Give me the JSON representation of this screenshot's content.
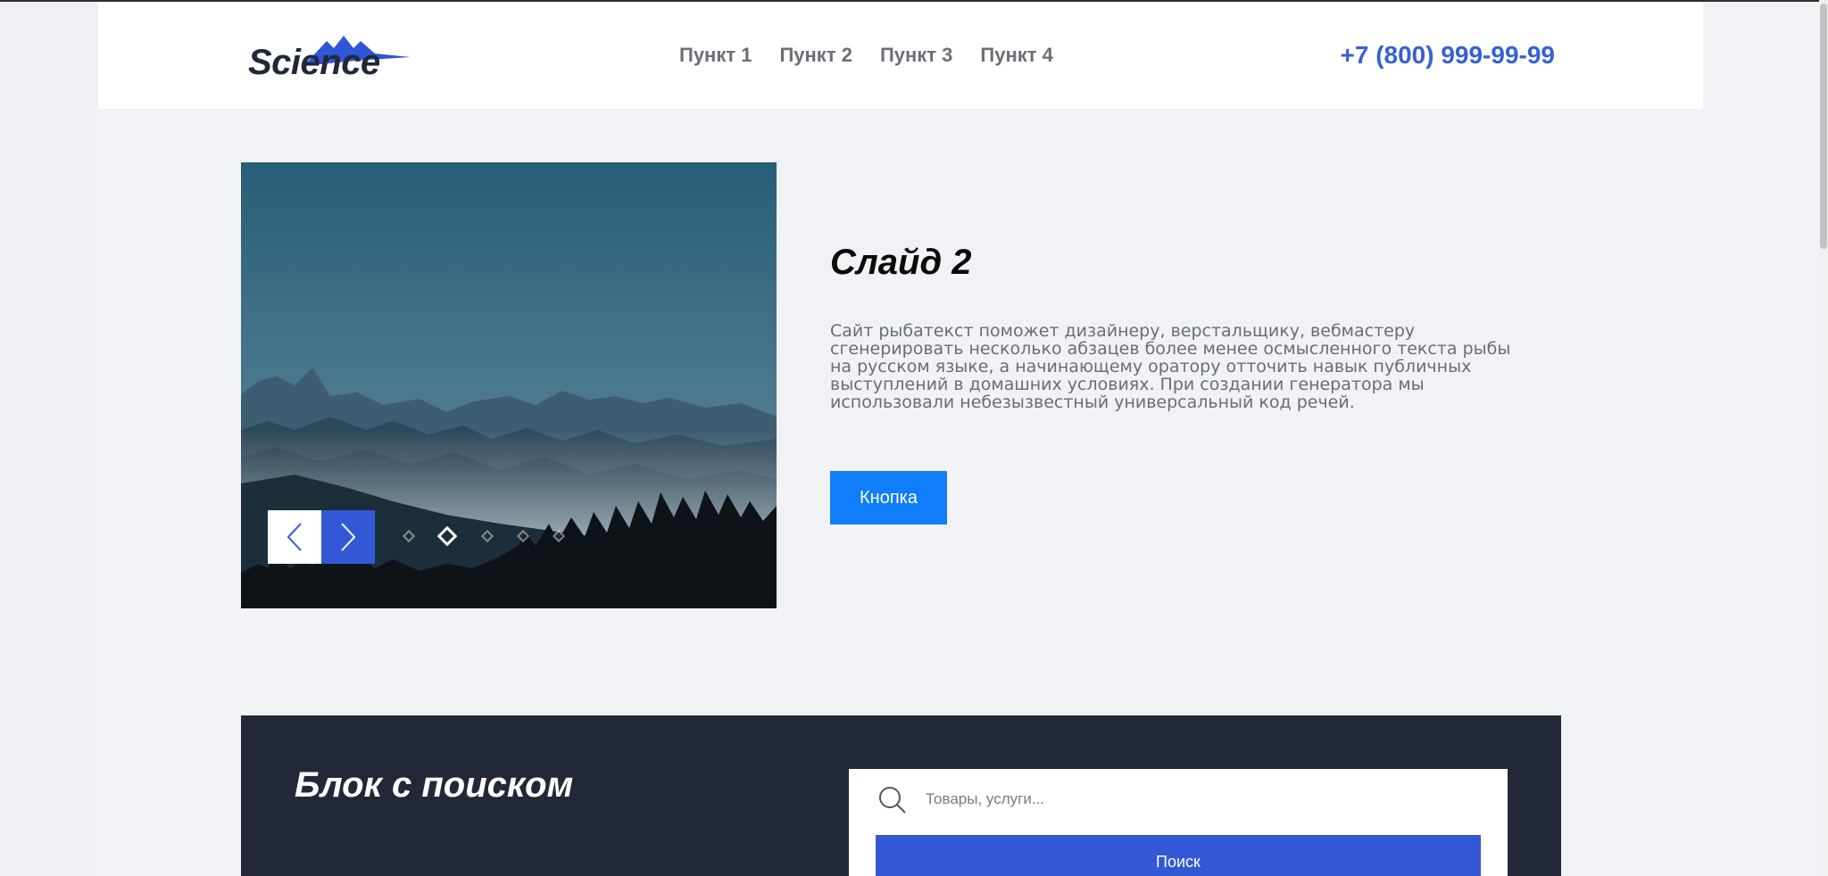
{
  "header": {
    "logo_text": "Science",
    "nav": [
      "Пункт 1",
      "Пункт 2",
      "Пункт 3",
      "Пункт 4"
    ],
    "phone": "+7 (800) 999-99-99"
  },
  "slider": {
    "title": "Слайд 2",
    "text": "Сайт рыбатекст поможет дизайнеру, верстальщику, вебмастеру сгенерировать несколько абзацев более менее осмысленного текста рыбы на русском языке, а начинающему оратору отточить навык публичных выступлений в домашних условиях. При создании генератора мы использовали небезызвестный универсальный код речей.",
    "button_label": "Кнопка",
    "dots_count": 5,
    "active_dot": 2,
    "image_icon": "mountains-image"
  },
  "search_block": {
    "title": "Блок с поиском",
    "placeholder": "Товары, услуги...",
    "button_label": "Поиск"
  },
  "colors": {
    "accent": "#3358d6",
    "button": "#0f7ef8",
    "dark_block": "#232838",
    "phone": "#3561d4"
  }
}
